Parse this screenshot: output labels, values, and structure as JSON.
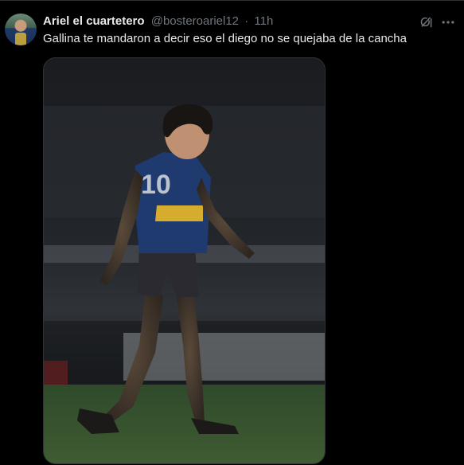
{
  "tweet": {
    "author_name": "Ariel el cuartetero",
    "handle": "@bosteroariel12",
    "separator": "·",
    "time": "11h",
    "text": "Gallina te mandaron a decir eso el diego no se quejaba de la cancha"
  },
  "icons": {
    "grok": "grok-icon",
    "more": "more-icon"
  },
  "colors": {
    "background": "#000000",
    "text_primary": "#e7e9ea",
    "text_secondary": "#71767b",
    "border": "#2f3336"
  }
}
